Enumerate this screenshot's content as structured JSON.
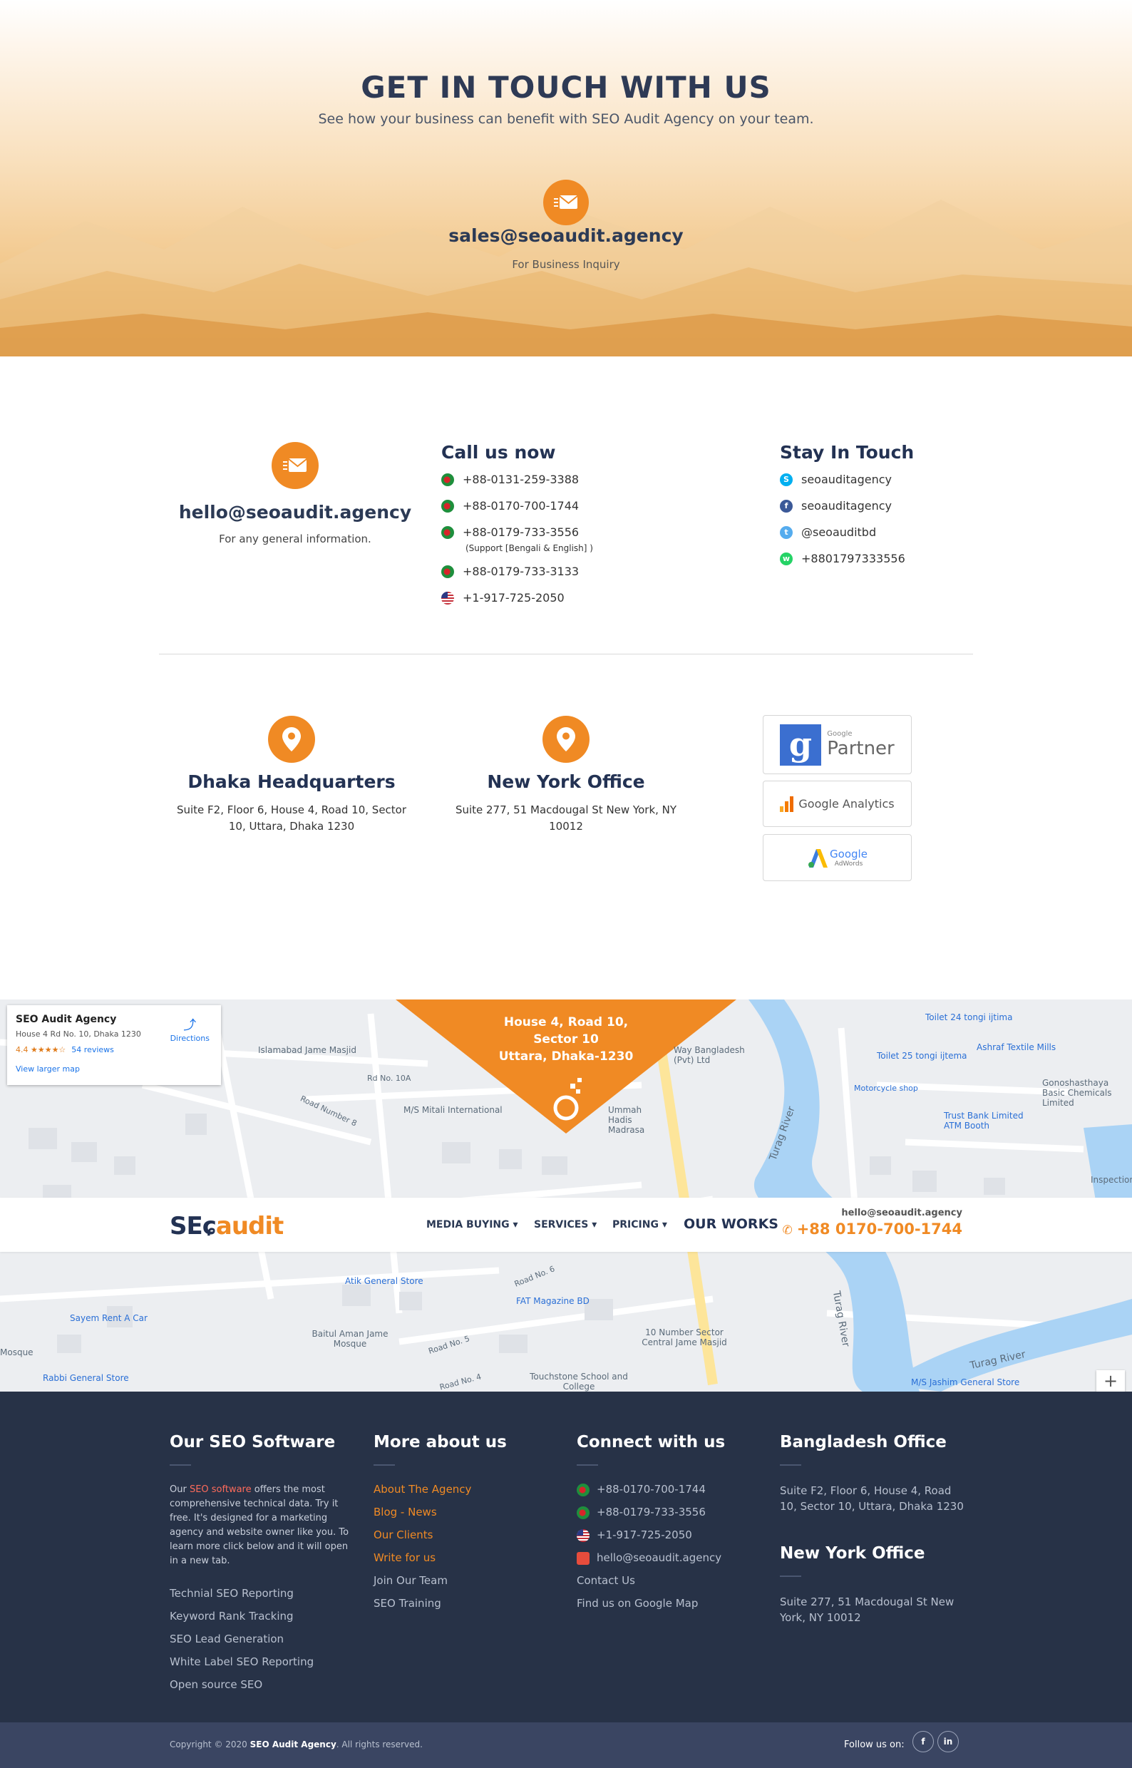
{
  "hero": {
    "title": "GET IN TOUCH WITH US",
    "subtitle": "See how your business can benefit with SEO Audit Agency on your team.",
    "email": "sales@seoaudit.agency",
    "email_caption": "For Business Inquiry",
    "icon": "envelope-icon"
  },
  "contact": {
    "email": "hello@seoaudit.agency",
    "email_caption": "For any general information.",
    "call": {
      "title": "Call us now",
      "phones": [
        {
          "flag": "bd",
          "number": "+88-0131-259-3388"
        },
        {
          "flag": "bd",
          "number": "+88-0170-700-1744"
        },
        {
          "flag": "bd",
          "number": "+88-0179-733-3556",
          "note": "(Support [Bengali & English] )"
        },
        {
          "flag": "bd",
          "number": "+88-0179-733-3133"
        },
        {
          "flag": "us",
          "number": "+1-917-725-2050"
        }
      ]
    },
    "stay": {
      "title": "Stay In Touch",
      "items": [
        {
          "icon": "skype-icon",
          "color": "#00aff0",
          "text": "seoauditagency"
        },
        {
          "icon": "facebook-icon",
          "color": "#3b5998",
          "text": "seoauditagency"
        },
        {
          "icon": "twitter-icon",
          "color": "#55acee",
          "text": "@seoauditbd"
        },
        {
          "icon": "whatsapp-icon",
          "color": "#25d366",
          "text": "+8801797333556"
        }
      ]
    }
  },
  "offices": [
    {
      "title": "Dhaka Headquarters",
      "address": "Suite F2, Floor 6, House 4, Road 10, Sector 10, Uttara, Dhaka 1230"
    },
    {
      "title": "New York Office",
      "address": "Suite 277, 51 Macdougal St New York, NY 10012"
    }
  ],
  "partners": {
    "google_partner": {
      "small": "Google",
      "big": "Partner"
    },
    "analytics": "Google Analytics",
    "adwords": {
      "big": "Google",
      "small": "AdWords"
    }
  },
  "map": {
    "card": {
      "name": "SEO Audit Agency",
      "address": "House 4 Rd No. 10, Dhaka 1230",
      "rating": "4.4 ★★★★☆",
      "reviews": "54 reviews",
      "directions": "Directions",
      "larger": "View larger map"
    },
    "pin_text": {
      "l1": "House 4, Road 10,",
      "l2": "Sector 10",
      "l3": "Uttara, Dhaka-1230"
    },
    "labels": {
      "islamabad": "Islamabad Jame Masjid",
      "mitali": "M/S Mitali International",
      "way_bd": "Way Bangladesh (Pvt) Ltd",
      "ummah": "Ummah Hadis Madrasa",
      "turag": "Turag River",
      "toilet24": "Toilet 24 tongi ijtima",
      "toilet25": "Toilet 25 tongi ijtema",
      "ashraf": "Ashraf Textile Mills",
      "moto": "Motorcycle shop",
      "trust": "Trust Bank Limited ATM Booth",
      "gono": "Gonoshasthaya Basic Chemicals Limited",
      "inspection": "Inspection for",
      "atik": "Atik General Store",
      "fat": "FAT Magazine BD",
      "sayem": "Sayem Rent A Car",
      "baitul": "Baitul Aman Jame Mosque",
      "ten": "10 Number Sector Central Jame Masjid",
      "rabbi": "Rabbi General Store",
      "touch": "Touchstone School and College",
      "jashim": "M/S Jashim General Store",
      "mosque": "Mosque",
      "rd10a": "Rd No. 10A",
      "rd8": "Road Number 8",
      "rd6": "Road No. 6",
      "rd5": "Road No. 5",
      "rd4": "Road No. 4",
      "zoom": "+"
    }
  },
  "nav": {
    "logo_a": "SE",
    "logo_b": "audit",
    "menu": [
      "MEDIA BUYING ▾",
      "SERVICES ▾",
      "PRICING ▾"
    ],
    "works": "OUR WORKS",
    "email": "hello@seoaudit.agency",
    "phone": "+88 0170-700-1744"
  },
  "footer": {
    "software": {
      "title": "Our SEO Software",
      "para_a": "Our ",
      "para_link": "SEO software",
      "para_b": " offers the most comprehensive technical data. Try it free. It's designed for a marketing agency and website owner like you. To learn more click below and it will open in a new tab.",
      "links": [
        "Technial SEO Reporting",
        "Keyword Rank Tracking",
        "SEO Lead Generation",
        "White Label SEO Reporting",
        "Open source SEO"
      ]
    },
    "more": {
      "title": "More about us",
      "links": [
        "About The Agency",
        "Blog - News",
        "Our Clients",
        "Write for us",
        "Join Our Team",
        "SEO Training"
      ]
    },
    "connect": {
      "title": "Connect with us",
      "items": [
        "+88-0170-700-1744",
        "+88-0179-733-3556",
        "+1-917-725-2050",
        "hello@seoaudit.agency",
        "Contact Us",
        "Find us on Google Map"
      ]
    },
    "bd_office": {
      "title": "Bangladesh Office",
      "address": "Suite F2, Floor 6, House 4, Road 10, Sector 10, Uttara, Dhaka 1230"
    },
    "ny_office": {
      "title": "New York Office",
      "address": "Suite 277, 51 Macdougal St New York, NY 10012"
    },
    "copyright_a": "Copyright © 2020 ",
    "copyright_b": "SEO Audit Agency",
    "copyright_c": ". All rights reserved.",
    "follow": "Follow us on:",
    "social": [
      "f",
      "in"
    ]
  }
}
